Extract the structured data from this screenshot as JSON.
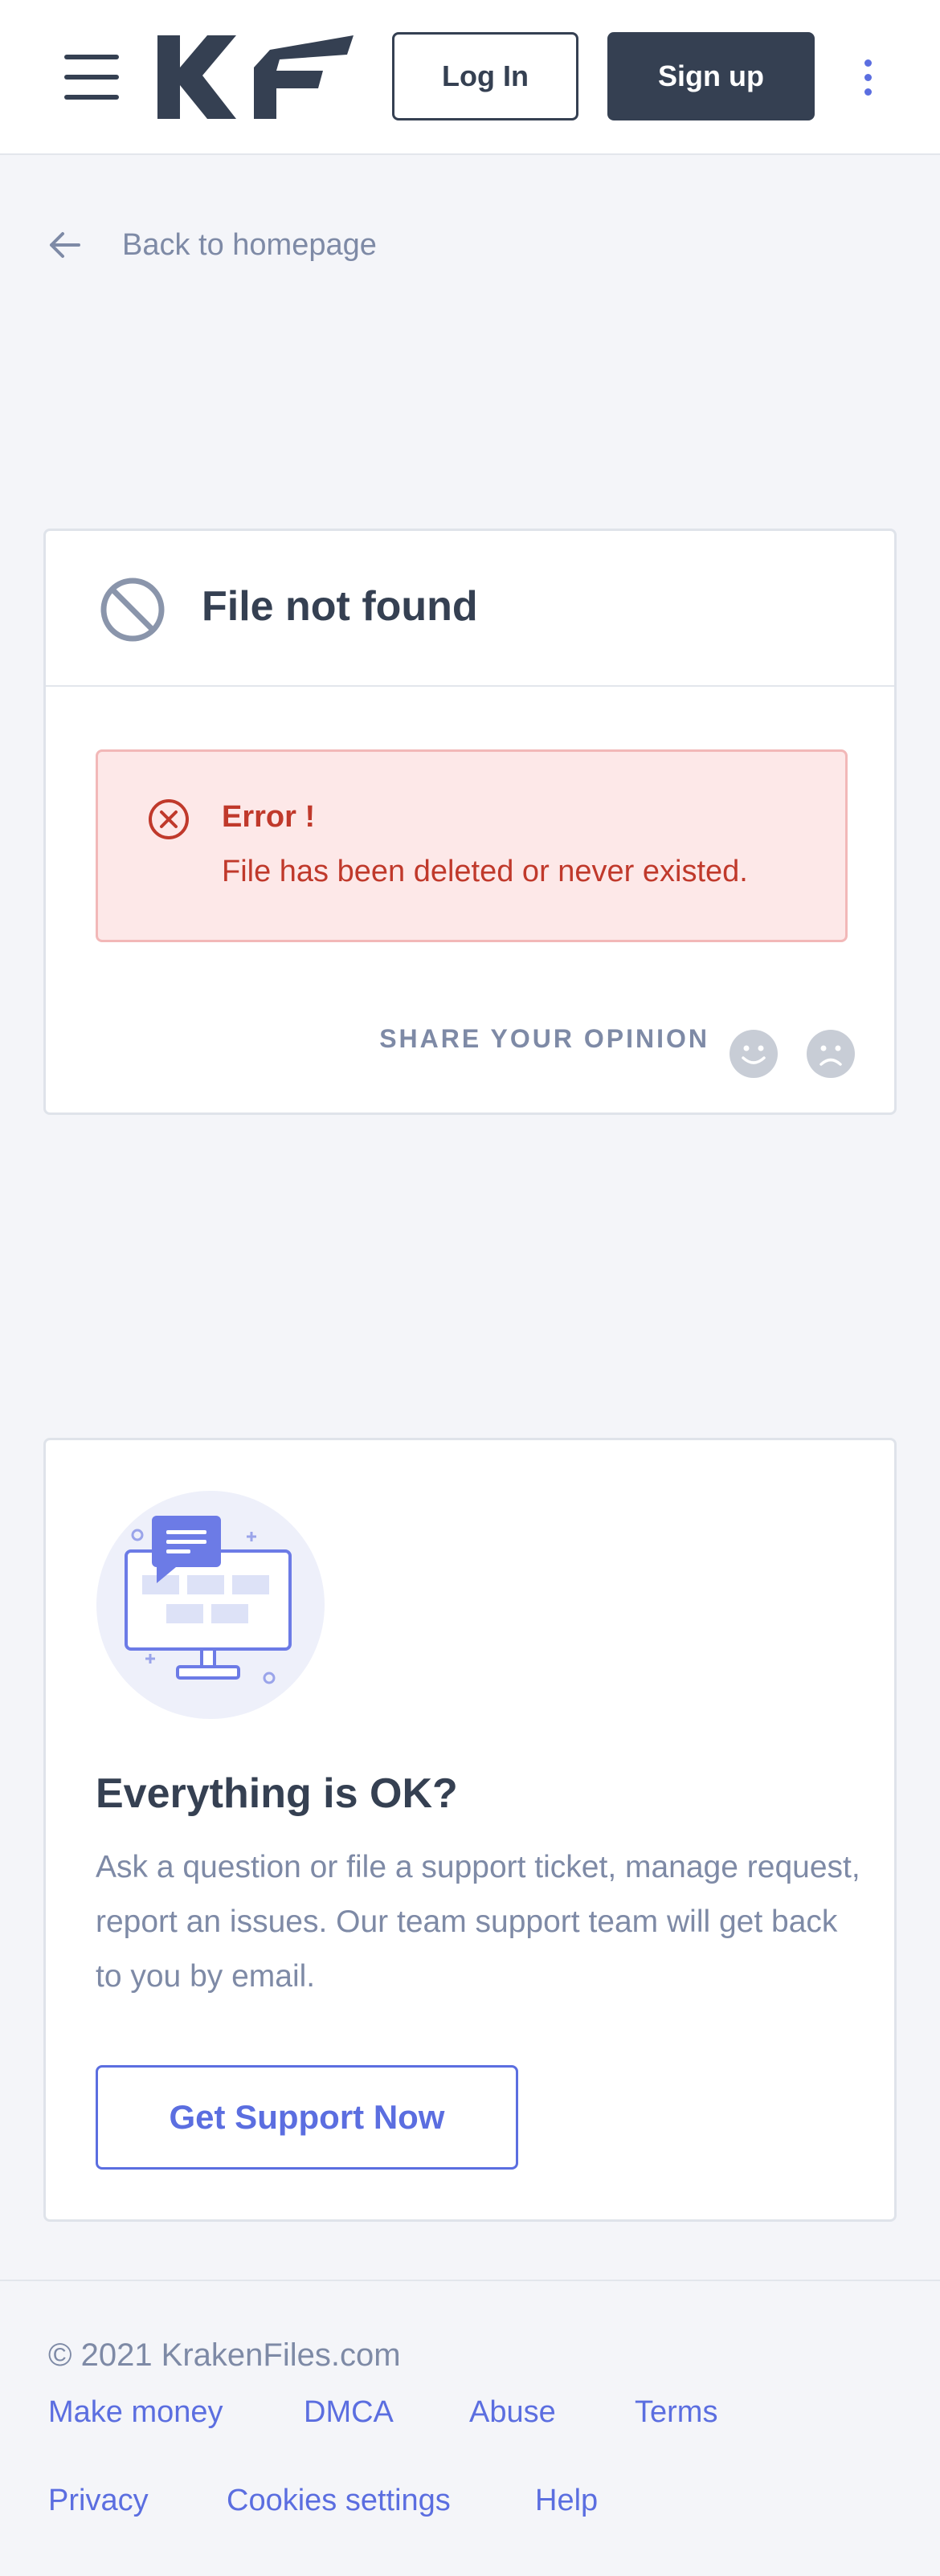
{
  "header": {
    "logo_text": "KF",
    "login_label": "Log In",
    "signup_label": "Sign up"
  },
  "nav": {
    "back_label": "Back to homepage"
  },
  "file_card": {
    "title": "File not found",
    "error_title": "Error !",
    "error_message": "File has been deleted or never existed.",
    "opinion_label": "SHARE YOUR OPINION"
  },
  "support_card": {
    "title": "Everything is OK?",
    "description": "Ask a question or file a support ticket, manage request, report an issues. Our team support team will get back to you by email.",
    "button_label": "Get Support Now"
  },
  "footer": {
    "copyright": "© 2021 KrakenFiles.com",
    "links": [
      "Make money",
      "DMCA",
      "Abuse",
      "Terms",
      "Privacy",
      "Cookies settings",
      "Help"
    ]
  },
  "colors": {
    "primary_dark": "#354052",
    "accent": "#5b6ee0",
    "error": "#c0392b",
    "error_bg": "#fde8e8",
    "muted": "#7e8aa6"
  },
  "icons": [
    "menu-icon",
    "more-vertical-icon",
    "arrow-left-icon",
    "ban-icon",
    "x-circle-icon",
    "smile-icon",
    "frown-icon",
    "support-illustration"
  ]
}
